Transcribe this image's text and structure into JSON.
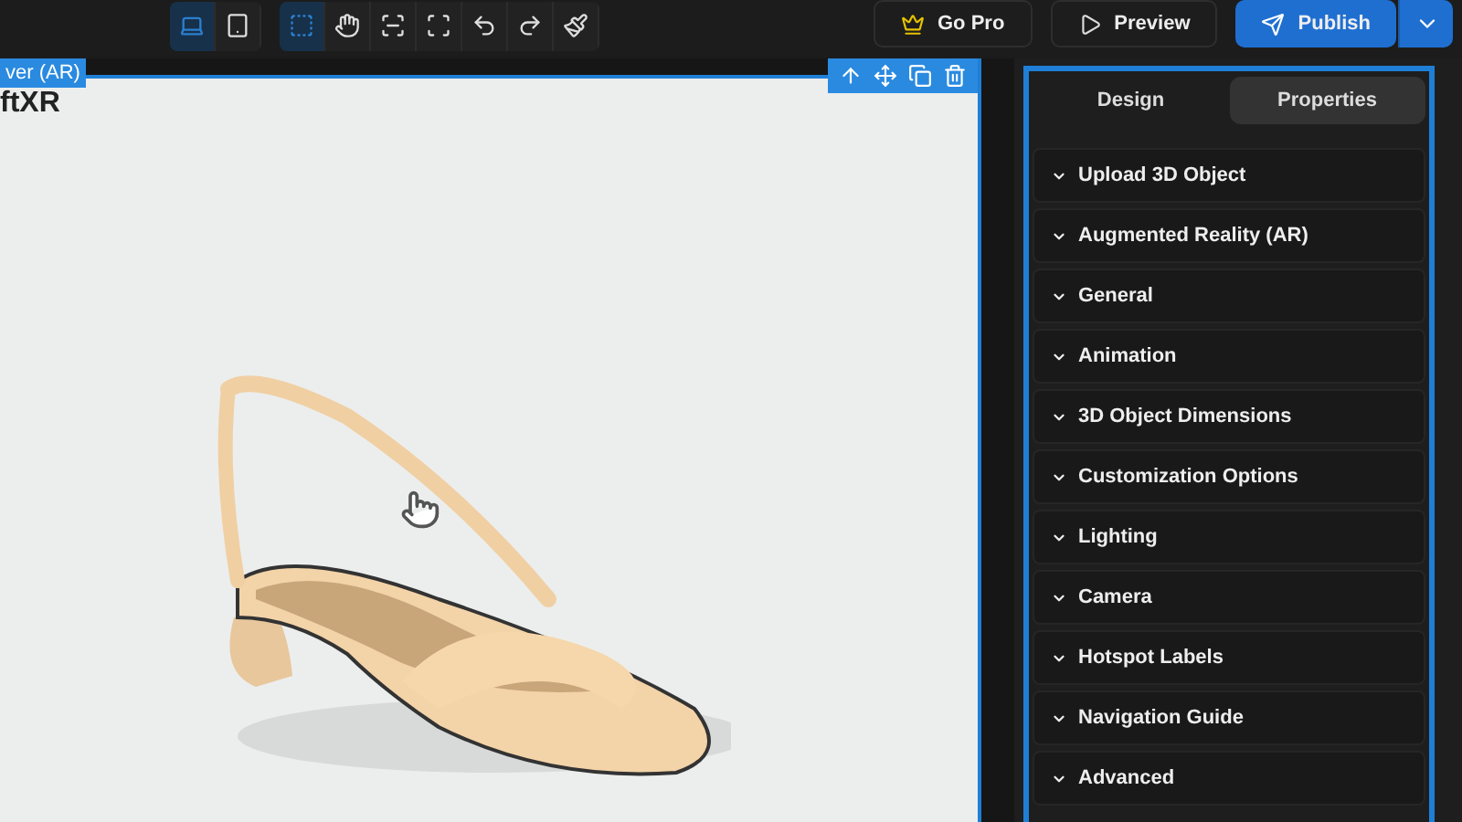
{
  "toolbar": {
    "device_buttons": [
      {
        "kind": "laptop",
        "selected": true
      },
      {
        "kind": "tablet",
        "selected": false
      }
    ],
    "tool_buttons": [
      {
        "kind": "select",
        "selected": true
      },
      {
        "kind": "hand",
        "selected": false
      },
      {
        "kind": "fit",
        "selected": false
      },
      {
        "kind": "fullscreen",
        "selected": false
      },
      {
        "kind": "undo",
        "selected": false
      },
      {
        "kind": "redo",
        "selected": false
      },
      {
        "kind": "clear",
        "selected": false
      }
    ],
    "actions": [
      {
        "kind": "pro",
        "label": "Go Pro"
      },
      {
        "kind": "preview",
        "label": "Preview"
      },
      {
        "kind": "publish",
        "label": "Publish"
      }
    ]
  },
  "canvas": {
    "widget_label": "ver (AR)",
    "heading": "ftXR"
  },
  "panel": {
    "tabs": [
      {
        "label": "Design",
        "selected": false
      },
      {
        "label": "Properties",
        "selected": true
      }
    ],
    "sections": [
      {
        "label": "Upload 3D Object",
        "expanded": false
      },
      {
        "label": "Augmented Reality (AR)",
        "expanded": false
      },
      {
        "label": "General",
        "expanded": false
      },
      {
        "label": "Animation",
        "expanded": false
      },
      {
        "label": "3D Object Dimensions",
        "expanded": false
      },
      {
        "label": "Customization Options",
        "expanded": false
      },
      {
        "label": "Lighting",
        "expanded": false
      },
      {
        "label": "Camera",
        "expanded": false
      },
      {
        "label": "Hotspot Labels",
        "expanded": false
      },
      {
        "label": "Navigation Guide",
        "expanded": false
      },
      {
        "label": "Advanced",
        "expanded": false
      }
    ]
  }
}
